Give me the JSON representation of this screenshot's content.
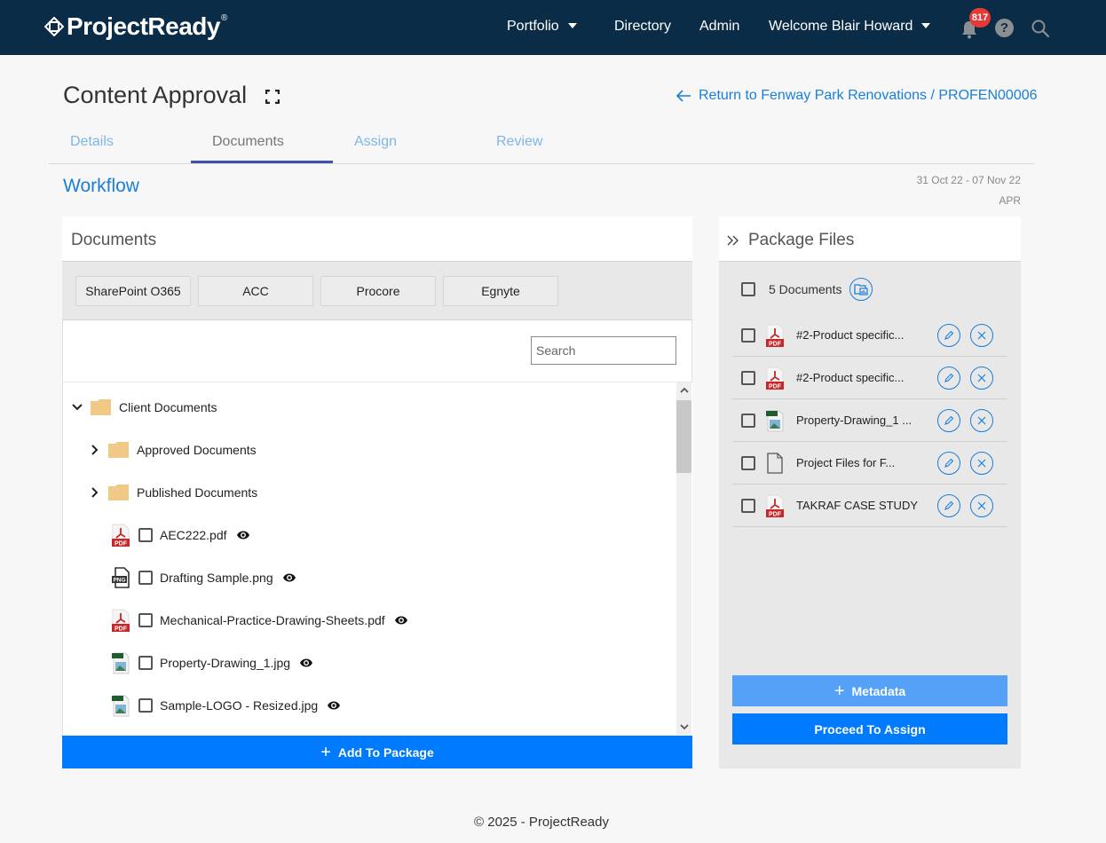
{
  "brand": {
    "name": "ProjectReady",
    "reg": "®"
  },
  "nav": {
    "portfolio": "Portfolio",
    "directory": "Directory",
    "admin": "Admin",
    "welcome": "Welcome Blair Howard",
    "notification_count": "817",
    "help_glyph": "?"
  },
  "header": {
    "title": "Content Approval",
    "return_link": "Return to Fenway Park Renovations / PROFEN00006"
  },
  "tabs": [
    {
      "label": "Details",
      "active": false
    },
    {
      "label": "Documents",
      "active": true
    },
    {
      "label": "Assign",
      "active": false
    },
    {
      "label": "Review",
      "active": false
    }
  ],
  "workflow": {
    "label": "Workflow",
    "date_range": "31 Oct 22 - 07 Nov 22",
    "code": "APR"
  },
  "documents_panel": {
    "title": "Documents",
    "sources": [
      "SharePoint O365",
      "ACC",
      "Procore",
      "Egnyte"
    ],
    "search_placeholder": "Search",
    "tree": [
      {
        "type": "folder",
        "name": "Client Documents",
        "expanded": true,
        "level": 0
      },
      {
        "type": "folder",
        "name": "Approved Documents",
        "expanded": false,
        "level": 1
      },
      {
        "type": "folder",
        "name": "Published Documents",
        "expanded": false,
        "level": 1
      },
      {
        "type": "file",
        "icon": "pdf",
        "name": "AEC222.pdf",
        "checked": false
      },
      {
        "type": "file",
        "icon": "png",
        "name": "Drafting Sample.png",
        "checked": false
      },
      {
        "type": "file",
        "icon": "pdf",
        "name": "Mechanical-Practice-Drawing-Sheets.pdf",
        "checked": false
      },
      {
        "type": "file",
        "icon": "jpg",
        "name": "Property-Drawing_1.jpg",
        "checked": false
      },
      {
        "type": "file",
        "icon": "jpg",
        "name": "Sample-LOGO - Resized.jpg",
        "checked": false
      }
    ],
    "add_button": "Add To Package"
  },
  "package_panel": {
    "title": "Package Files",
    "count_label": "5 Documents",
    "files": [
      {
        "icon": "pdf",
        "name": "#2-Product specific..."
      },
      {
        "icon": "pdf",
        "name": "#2-Product specific..."
      },
      {
        "icon": "jpg",
        "name": "Property-Drawing_1 ..."
      },
      {
        "icon": "generic",
        "name": "Project Files for F..."
      },
      {
        "icon": "pdf",
        "name": "TAKRAF CASE STUDY"
      }
    ],
    "metadata_button": "Metadata",
    "proceed_button": "Proceed To Assign"
  },
  "colors": {
    "topbar": "#0b2c47",
    "primary": "#007bff",
    "primary_light": "#55a1f7",
    "link": "#1a7fd9",
    "badge": "#e53935",
    "folder": "#f0c987",
    "pdf": "#c62828"
  },
  "footer": {
    "text": "© 2025 - ProjectReady"
  }
}
